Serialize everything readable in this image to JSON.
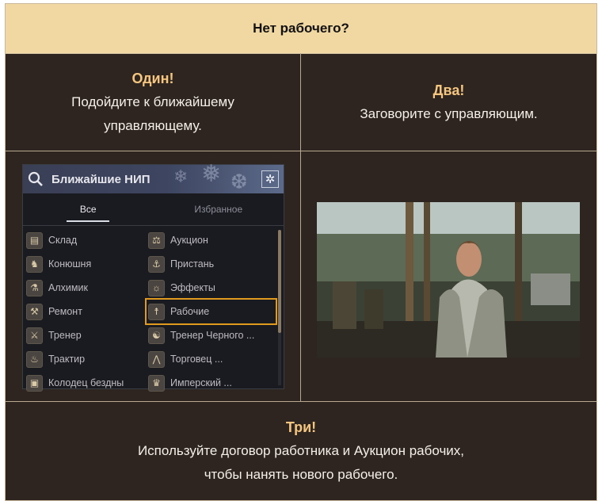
{
  "header": {
    "title": "Нет рабочего?"
  },
  "step1": {
    "step": "Один!",
    "line1": "Подойдите к ближайшему",
    "line2": "управляющему."
  },
  "step2": {
    "step": "Два!",
    "line1": "Заговорите с управляющим."
  },
  "step3": {
    "step": "Три!",
    "line1": "Используйте договор работника и Аукцион рабочих,",
    "line2": "чтобы нанять нового рабочего."
  },
  "npc_panel": {
    "title": "Ближайшие НИП",
    "tabs": [
      "Все",
      "Избранное"
    ],
    "active_tab": "Все",
    "left_items": [
      {
        "label": "Склад",
        "icon": "storage-icon"
      },
      {
        "label": "Конюшня",
        "icon": "horse-icon"
      },
      {
        "label": "Алхимик",
        "icon": "flask-icon"
      },
      {
        "label": "Ремонт",
        "icon": "anvil-icon"
      },
      {
        "label": "Тренер",
        "icon": "crossed-swords-icon"
      },
      {
        "label": "Трактир",
        "icon": "roast-icon"
      },
      {
        "label": "Колодец бездны",
        "icon": "well-icon"
      }
    ],
    "right_items": [
      {
        "label": "Аукцион",
        "icon": "scales-icon"
      },
      {
        "label": "Пристань",
        "icon": "anchor-icon"
      },
      {
        "label": "Эффекты",
        "icon": "sun-icon"
      },
      {
        "label": "Рабочие",
        "icon": "worker-icon",
        "selected": true
      },
      {
        "label": "Тренер Черного ...",
        "icon": "spirit-icon"
      },
      {
        "label": "Торговец ...",
        "icon": "tent-icon"
      },
      {
        "label": "Имперский ...",
        "icon": "crown-icon"
      }
    ],
    "highlight_color": "#e09a1e"
  },
  "colors": {
    "header_bg": "#f1d7a1",
    "body_bg": "#2e2520",
    "step_accent": "#f4c680"
  }
}
